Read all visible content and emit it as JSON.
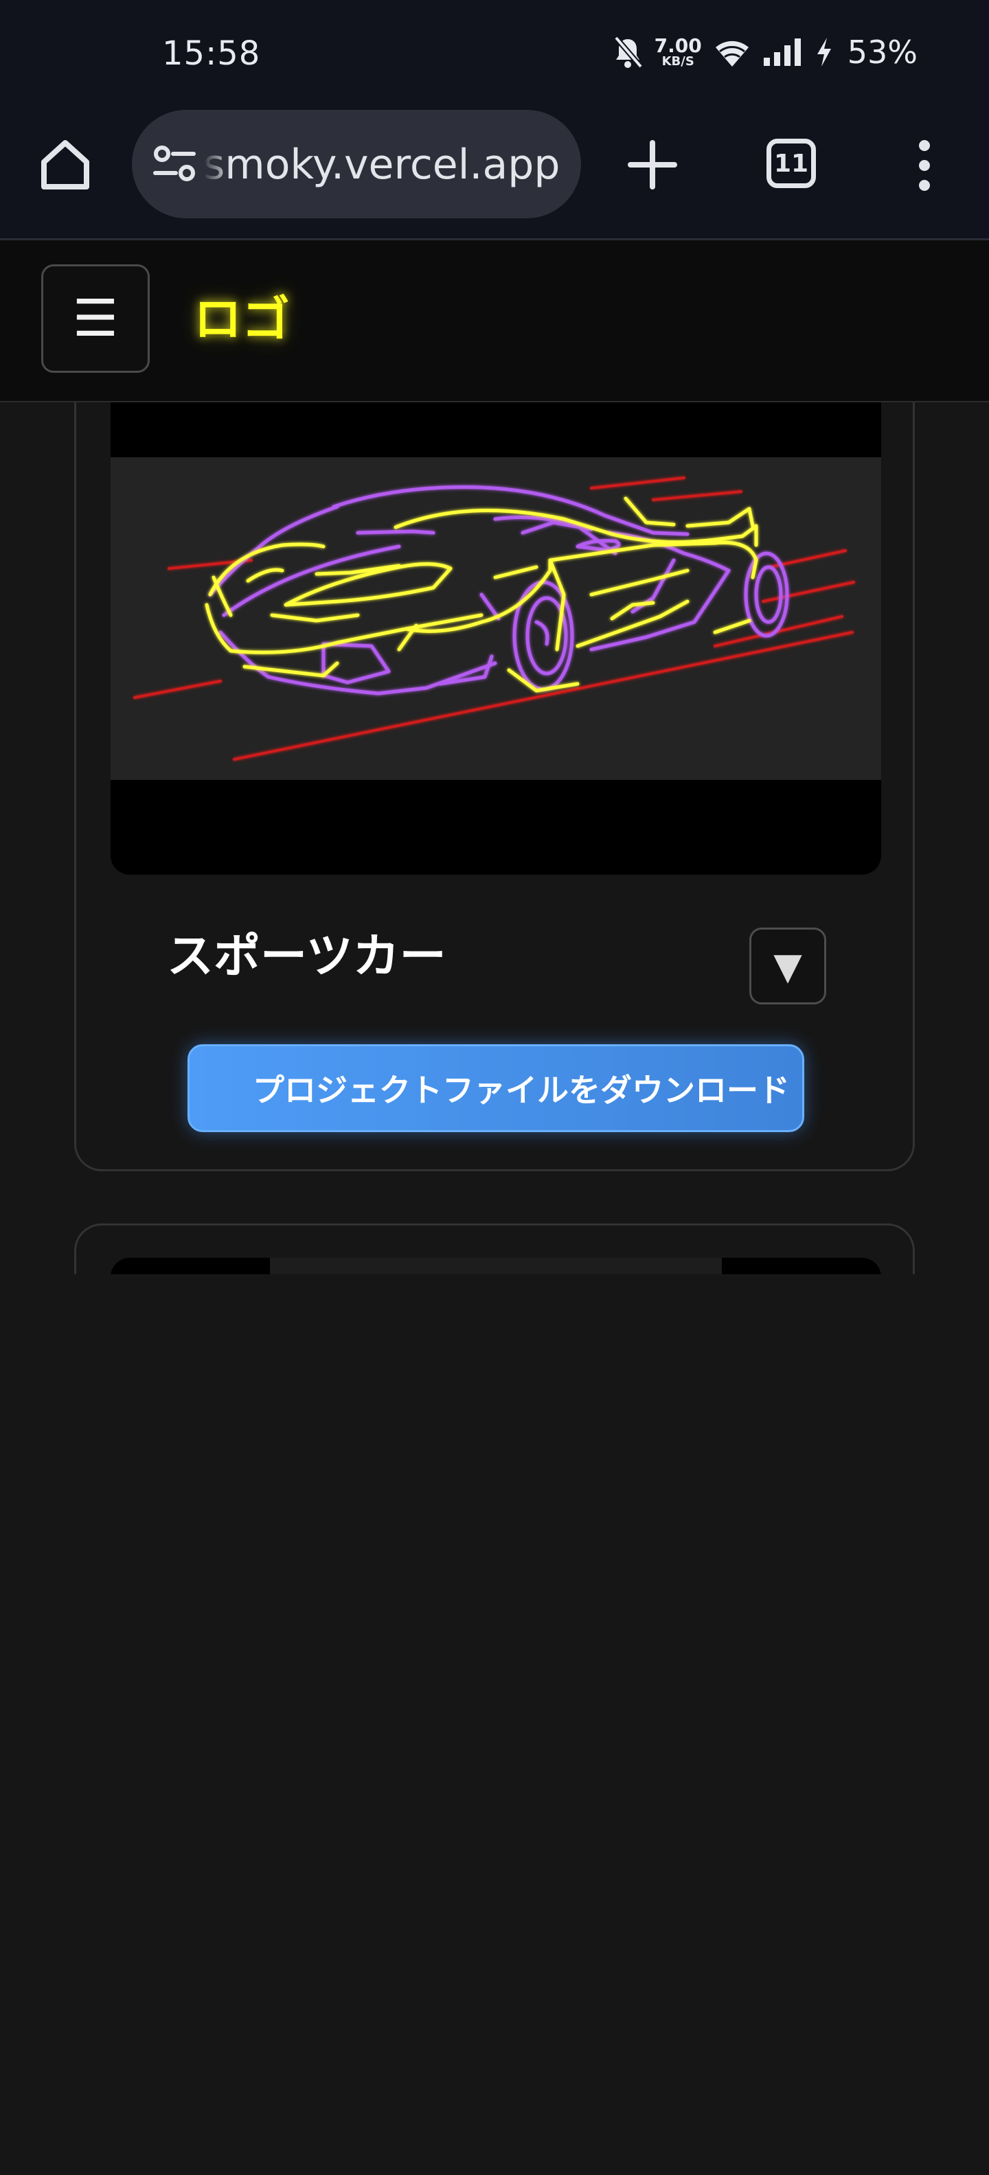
{
  "status_bar": {
    "time": "15:58",
    "net_speed_value": "7.00",
    "net_speed_unit": "KB/S",
    "battery": "53%",
    "icons": [
      "bell-off-icon",
      "wifi-icon",
      "signal-icon",
      "charging-bolt-icon"
    ]
  },
  "browser": {
    "url": "smoky.vercel.app",
    "tab_count": "11",
    "icons": [
      "home-icon",
      "site-settings-icon",
      "plus-icon",
      "more-vert-icon"
    ]
  },
  "header": {
    "menu_glyph": "☰",
    "logo": "ロゴ"
  },
  "card": {
    "title": "スポーツカー",
    "toggle_glyph": "▼",
    "download_label": "プロジェクトファイルをダウンロード",
    "colors": {
      "outline_yellow": "#ffff3a",
      "outline_purple": "#b35cf0",
      "speed_lines_red": "#d01a1a",
      "button_blue": "#4e9cf6"
    }
  }
}
